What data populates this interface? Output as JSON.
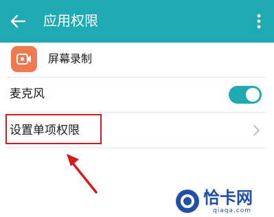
{
  "header": {
    "title": "应用权限",
    "back_icon": "arrow-left-icon",
    "more_icon": "more-vertical-icon",
    "background_color": "#1fa9b3"
  },
  "app": {
    "name": "屏幕录制",
    "icon": "screen-recorder-icon",
    "icon_color": "#f07a4f"
  },
  "settings": {
    "microphone": {
      "label": "麦克风",
      "enabled": true
    },
    "single_permission": {
      "label": "设置单项权限",
      "icon": "chevron-right-icon"
    }
  },
  "annotation": {
    "color": "#d61a1a"
  },
  "watermark": {
    "text": "恰卡网",
    "url": "qiaqa.com",
    "color": "#1f4fa6"
  }
}
